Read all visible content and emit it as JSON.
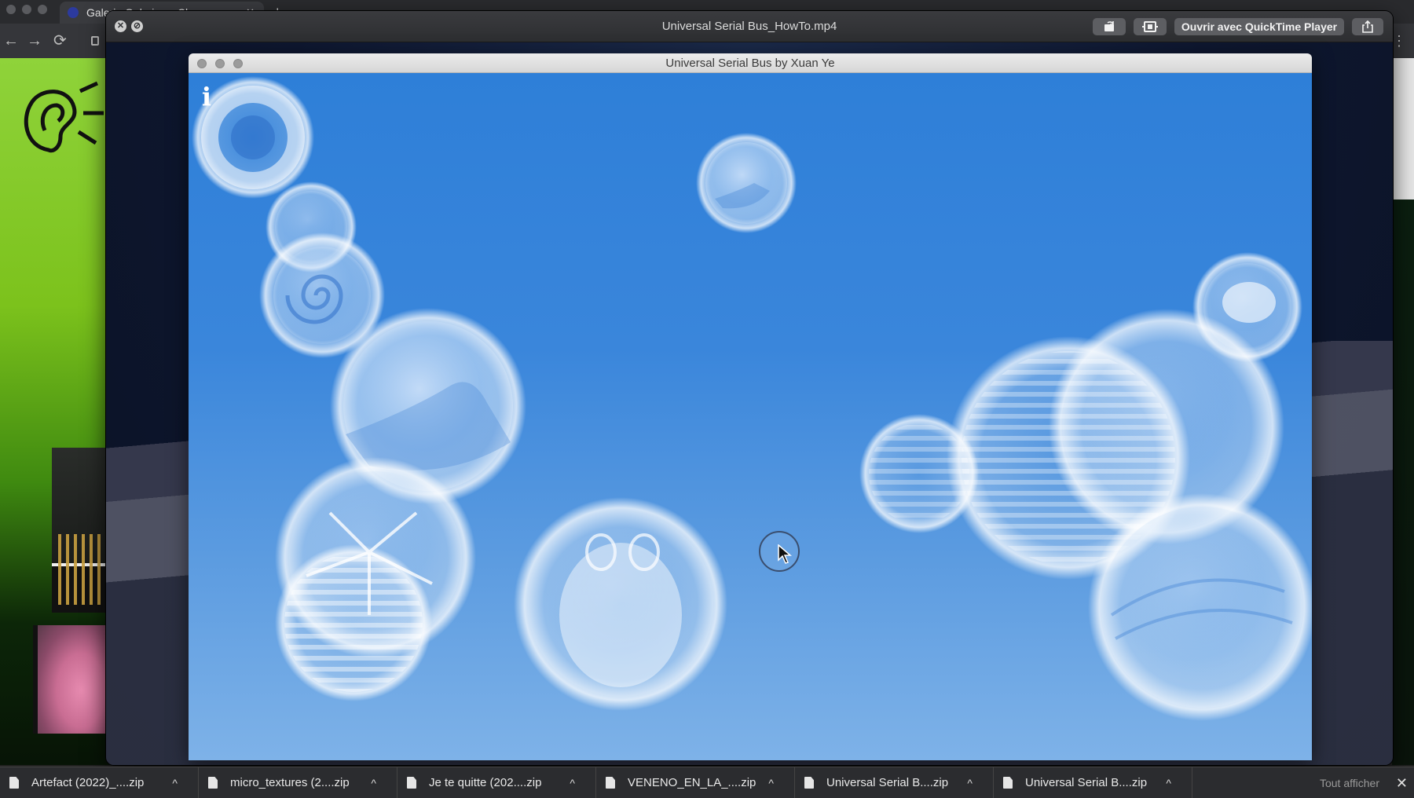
{
  "browser": {
    "tab_title": "Galerie Galerie — Clone…",
    "tab_close": "✕",
    "new_tab": "+",
    "back": "←",
    "forward": "→",
    "reload": "⟳",
    "menu": "⋮"
  },
  "quicktime": {
    "title": "Universal Serial Bus_HowTo.mp4",
    "close_glyph": "✕",
    "min_glyph": "⊘",
    "rotate_icon": "rotate-icon",
    "trim_icon": "trim-icon",
    "open_button": "Ouvrir avec QuickTime Player",
    "share_icon": "share-icon"
  },
  "app": {
    "title": "Universal Serial Bus by Xuan Ye",
    "info": "i"
  },
  "downloads": {
    "items": [
      {
        "name": "Artefact (2022)_....zip"
      },
      {
        "name": "micro_textures (2....zip"
      },
      {
        "name": "Je te quitte (202....zip"
      },
      {
        "name": "VENENO_EN_LA_....zip"
      },
      {
        "name": "Universal Serial B....zip"
      },
      {
        "name": "Universal Serial B....zip"
      }
    ],
    "chevron": "^",
    "show_all": "Tout afficher",
    "close": "✕"
  },
  "colors": {
    "canvas_top": "#2e7fd8",
    "canvas_bottom": "#7eb2e8",
    "bubble": "#ffffff"
  }
}
